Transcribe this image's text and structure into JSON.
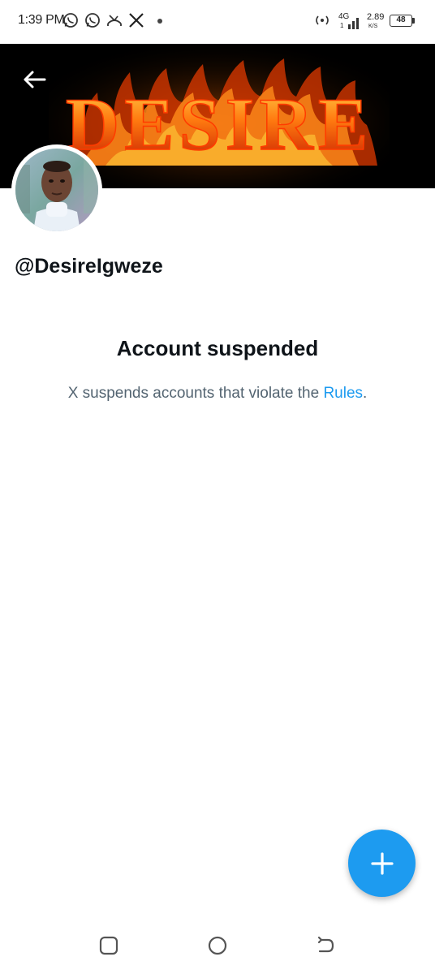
{
  "status_bar": {
    "time": "1:39 PM",
    "notification_icons": [
      "whatsapp-icon",
      "whatsapp-icon",
      "missed-call-icon",
      "x-logo-icon",
      "dot-icon"
    ],
    "network": "4G",
    "network_sub": "1",
    "speed_value": "2.89",
    "speed_unit": "K/S",
    "battery": "48"
  },
  "banner": {
    "title": "DESIRE",
    "colors": {
      "fire": "#ff5a00",
      "fire_light": "#ffc23a",
      "background": "#000000"
    }
  },
  "profile": {
    "handle": "@DesireIgweze"
  },
  "suspension": {
    "title": "Account suspended",
    "message_prefix": "X suspends accounts that violate the ",
    "rules_link": "Rules",
    "message_suffix": "."
  },
  "fab": {
    "icon": "plus-icon",
    "color": "#1d9bf0"
  },
  "nav_bar": {
    "icons": [
      "recents-icon",
      "home-circle-icon",
      "back-nav-icon"
    ]
  }
}
